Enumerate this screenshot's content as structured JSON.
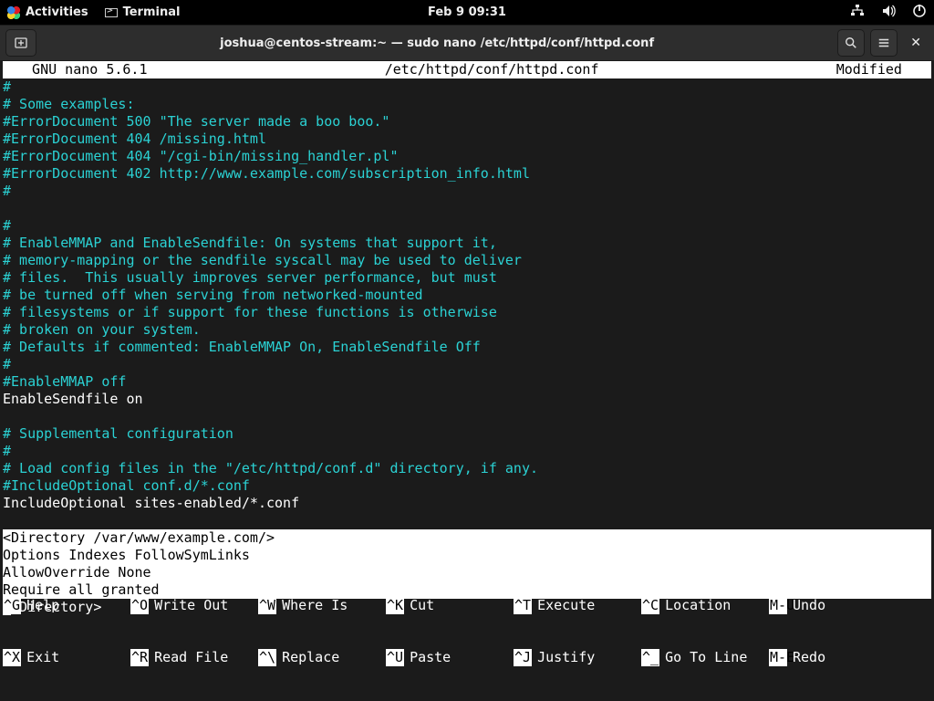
{
  "topbar": {
    "activities": "Activities",
    "app": "Terminal",
    "datetime": "Feb 9  09:31"
  },
  "window": {
    "title": "joshua@centos-stream:~ — sudo nano /etc/httpd/conf/httpd.conf"
  },
  "nano": {
    "status_left": "  GNU nano 5.6.1",
    "status_center": "/etc/httpd/conf/httpd.conf",
    "status_right": "Modified  ",
    "lines_cyan_1": "#\n# Some examples:\n#ErrorDocument 500 \"The server made a boo boo.\"\n#ErrorDocument 404 /missing.html\n#ErrorDocument 404 \"/cgi-bin/missing_handler.pl\"\n#ErrorDocument 402 http://www.example.com/subscription_info.html\n#\n",
    "lines_cyan_2": "#\n# EnableMMAP and EnableSendfile: On systems that support it,\n# memory-mapping or the sendfile syscall may be used to deliver\n# files.  This usually improves server performance, but must\n# be turned off when serving from networked-mounted\n# filesystems or if support for these functions is otherwise\n# broken on your system.\n# Defaults if commented: EnableMMAP On, EnableSendfile Off\n#\n#EnableMMAP off",
    "line_plain_1": "EnableSendfile on",
    "lines_cyan_3": "# Supplemental configuration\n#\n# Load config files in the \"/etc/httpd/conf.d\" directory, if any.\n#IncludeOptional conf.d/*.conf",
    "line_plain_2": "IncludeOptional sites-enabled/*.conf",
    "highlight_block": "<Directory /var/www/example.com/>\nOptions Indexes FollowSymLinks\nAllowOverride None\nRequire all granted",
    "last_line_cursor": "<",
    "last_line_rest": "/Directory>",
    "shortcuts": {
      "row1": [
        {
          "key": "^G",
          "label": "Help"
        },
        {
          "key": "^O",
          "label": "Write Out"
        },
        {
          "key": "^W",
          "label": "Where Is"
        },
        {
          "key": "^K",
          "label": "Cut"
        },
        {
          "key": "^T",
          "label": "Execute"
        },
        {
          "key": "^C",
          "label": "Location"
        },
        {
          "key": "M-U",
          "label": "Undo"
        }
      ],
      "row2": [
        {
          "key": "^X",
          "label": "Exit"
        },
        {
          "key": "^R",
          "label": "Read File"
        },
        {
          "key": "^\\",
          "label": "Replace"
        },
        {
          "key": "^U",
          "label": "Paste"
        },
        {
          "key": "^J",
          "label": "Justify"
        },
        {
          "key": "^_",
          "label": "Go To Line"
        },
        {
          "key": "M-E",
          "label": "Redo"
        }
      ]
    }
  }
}
